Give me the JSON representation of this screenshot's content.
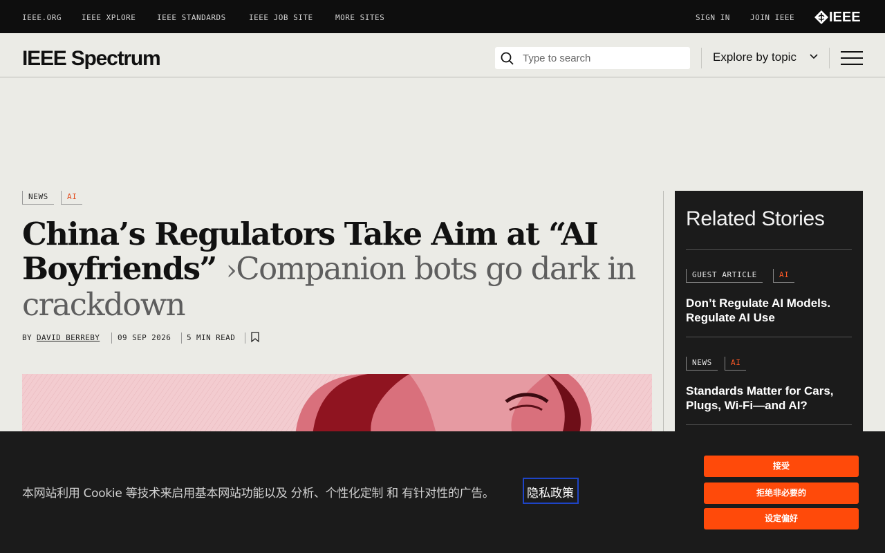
{
  "topbar": {
    "links": [
      "IEEE.ORG",
      "IEEE XPLORE",
      "IEEE STANDARDS",
      "IEEE JOB SITE",
      "MORE SITES"
    ],
    "sign_in": "SIGN IN",
    "join": "JOIN IEEE",
    "logo_text": "IEEE"
  },
  "header": {
    "brand": "IEEE Spectrum",
    "search_placeholder": "Type to search",
    "explore": "Explore by topic"
  },
  "article": {
    "tags": [
      "NEWS",
      "AI"
    ],
    "title": "China’s Regulators Take Aim at “AI Boyfriends”",
    "separator": "›",
    "subtitle": "Companion bots go dark in crackdown",
    "by": "BY",
    "author": "DAVID BERREBY",
    "date": "09 SEP 2026",
    "read_time": "5 MIN READ"
  },
  "sidebar": {
    "heading": "Related Stories",
    "stories": [
      {
        "tags": [
          "GUEST ARTICLE",
          "AI"
        ],
        "title": "Don’t Regulate AI Models. Regulate AI Use"
      },
      {
        "tags": [
          "NEWS",
          "AI"
        ],
        "title": "Standards Matter for Cars, Plugs, Wi-Fi—and AI?"
      }
    ]
  },
  "cookie": {
    "text": "本网站利用 Cookie 等技术来启用基本网站功能以及 分析、个性化定制 和 有针对性的广告。",
    "policy_link": "隐私政策",
    "accept": "接受",
    "reject": "拒绝非必要的",
    "preferences": "设定偏好"
  },
  "colors": {
    "accent": "#ff4a0a",
    "tag_ai": "#e24c1e",
    "topbar_bg": "#0e0e0e",
    "page_bg": "#ebebe6",
    "sidebar_bg": "#1b1b1b"
  }
}
